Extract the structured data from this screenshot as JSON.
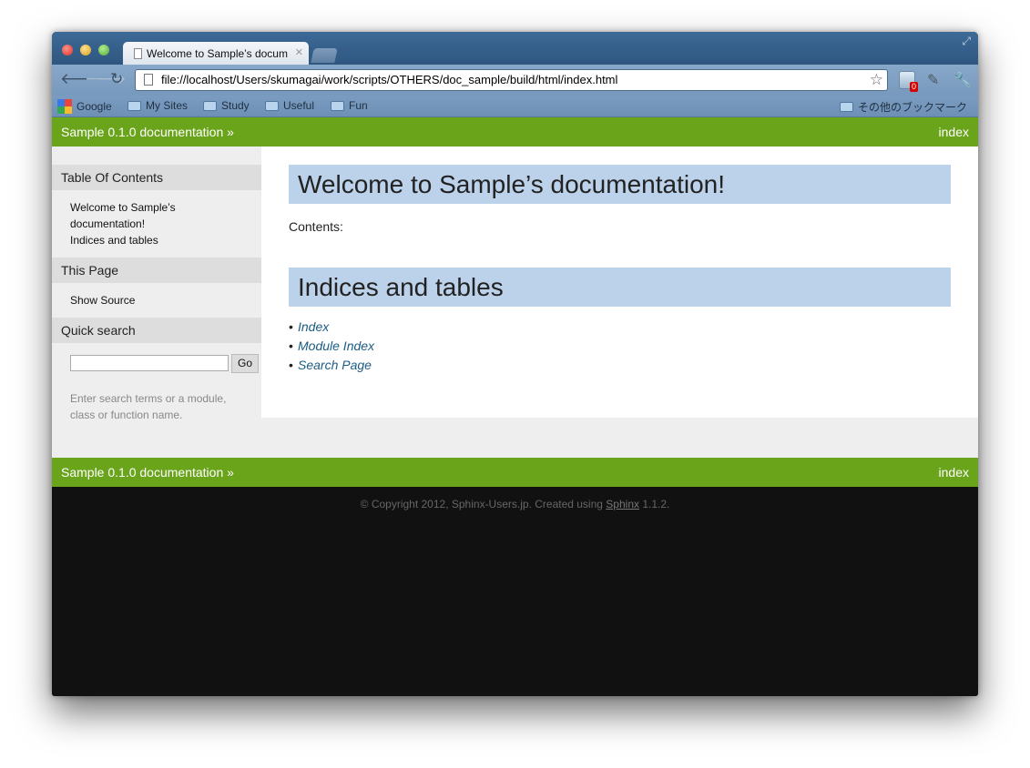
{
  "browser": {
    "tab_title": "Welcome to Sample’s docum",
    "url": "file://localhost/Users/skumagai/work/scripts/OTHERS/doc_sample/build/html/index.html",
    "extension_badge": "0",
    "bookmarks": [
      "Google",
      "My Sites",
      "Study",
      "Useful",
      "Fun"
    ],
    "other_bookmarks": "その他のブックマーク"
  },
  "relbar": {
    "breadcrumb": "Sample 0.1.0 documentation »",
    "index_link": "index"
  },
  "sidebar": {
    "toc_heading": "Table Of Contents",
    "toc_items": [
      "Welcome to Sample’s",
      "documentation!",
      "Indices and tables"
    ],
    "this_page_heading": "This Page",
    "show_source": "Show Source",
    "quick_search_heading": "Quick search",
    "go_label": "Go",
    "search_help_line1": "Enter search terms or a module,",
    "search_help_line2": "class or function name."
  },
  "content": {
    "title": "Welcome to Sample’s documentation!",
    "contents_label": "Contents:",
    "indices_heading": "Indices and tables",
    "links": [
      "Index",
      "Module Index",
      "Search Page"
    ]
  },
  "footer": {
    "copyright": "© Copyright 2012, Sphinx-Users.jp. Created using ",
    "sphinx_link": "Sphinx",
    "version_suffix": " 1.1.2."
  }
}
